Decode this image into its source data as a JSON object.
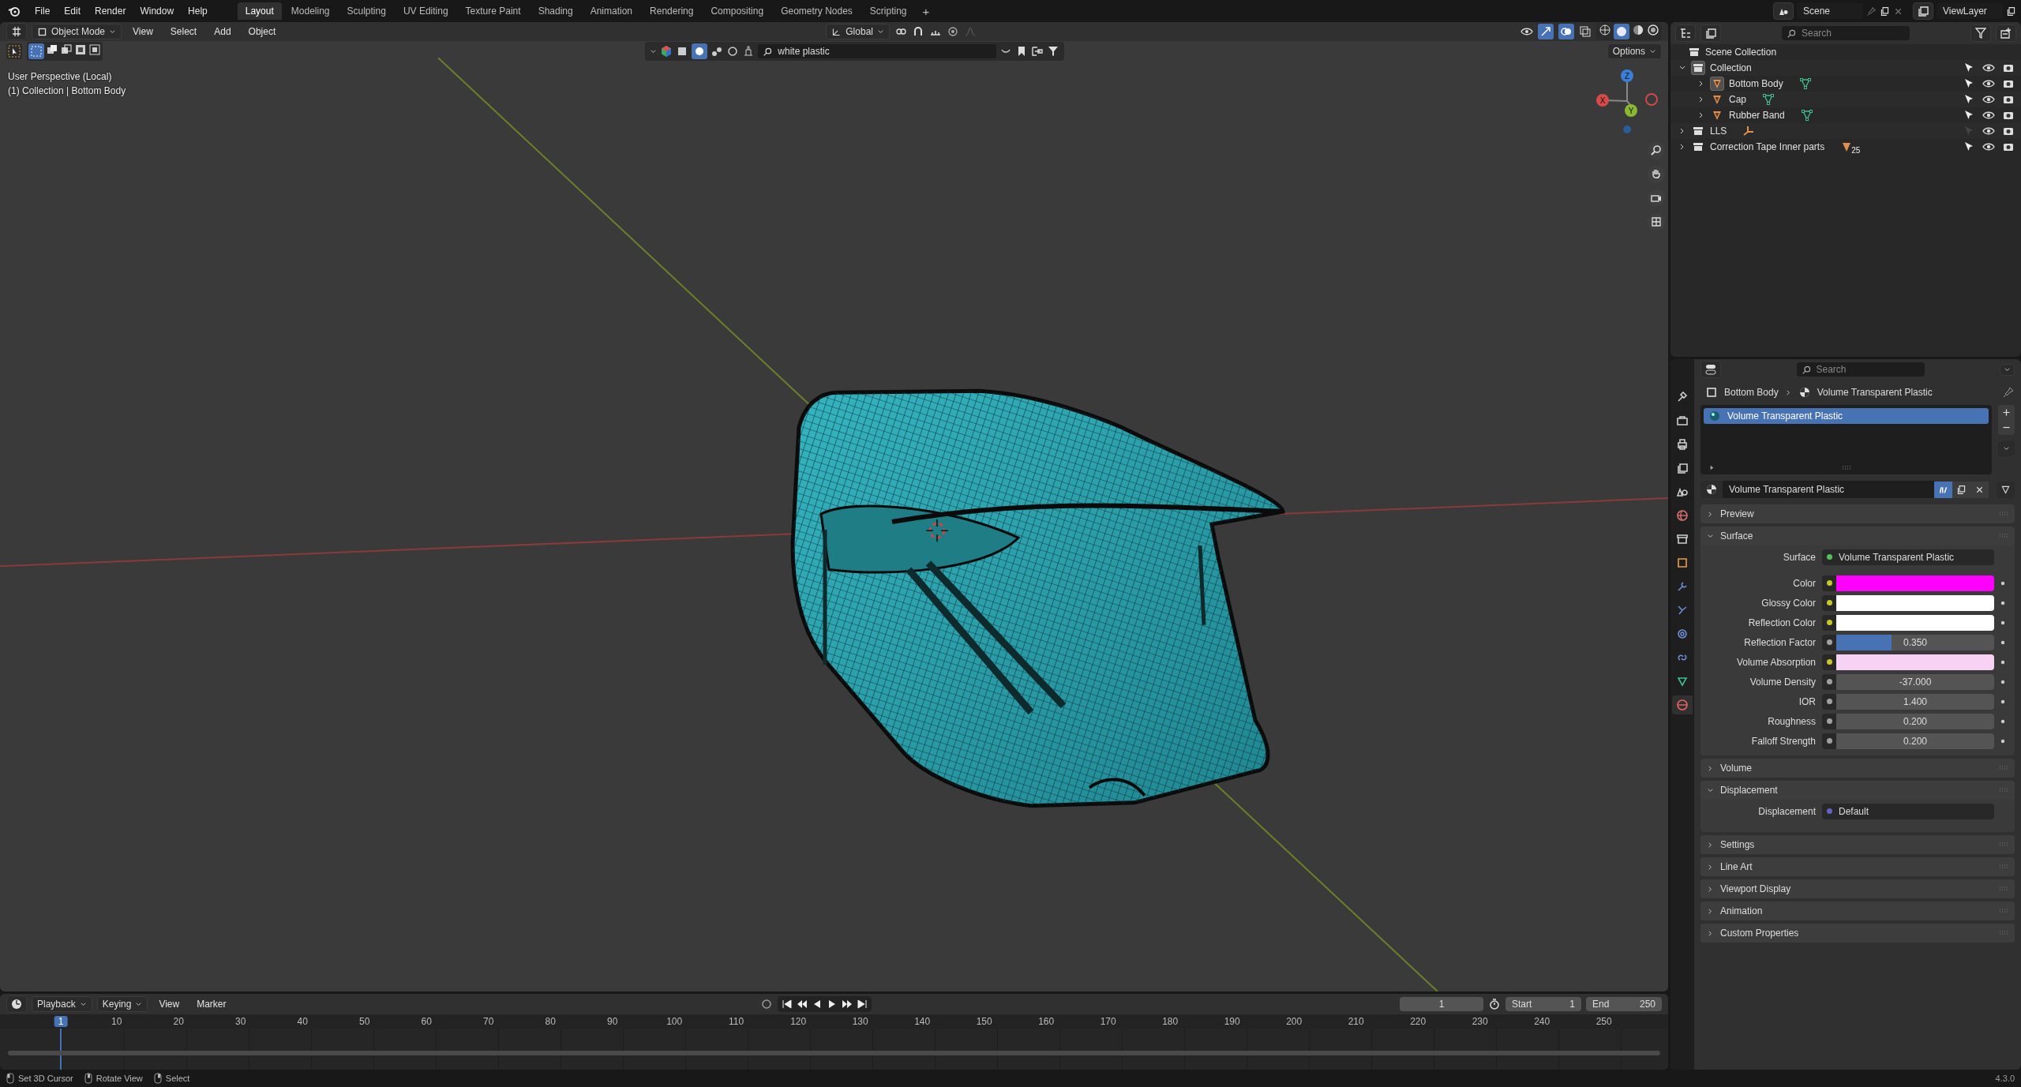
{
  "menu_bar": {
    "menus": [
      "File",
      "Edit",
      "Render",
      "Window",
      "Help"
    ],
    "workspaces": [
      {
        "label": "Layout",
        "selected": true
      },
      {
        "label": "Modeling",
        "selected": false
      },
      {
        "label": "Sculpting",
        "selected": false
      },
      {
        "label": "UV Editing",
        "selected": false
      },
      {
        "label": "Texture Paint",
        "selected": false
      },
      {
        "label": "Shading",
        "selected": false
      },
      {
        "label": "Animation",
        "selected": false
      },
      {
        "label": "Rendering",
        "selected": false
      },
      {
        "label": "Compositing",
        "selected": false
      },
      {
        "label": "Geometry Nodes",
        "selected": false
      },
      {
        "label": "Scripting",
        "selected": false
      }
    ],
    "add_tab": "+",
    "scene": "Scene",
    "view_layer": "ViewLayer"
  },
  "viewport": {
    "mode": "Object Mode",
    "menus": [
      "View",
      "Select",
      "Add",
      "Object"
    ],
    "orientation": "Global",
    "search": "white plastic",
    "options": "Options",
    "info": [
      "User Perspective (Local)",
      "(1) Collection | Bottom Body"
    ],
    "gizmo_labels": [
      "X",
      "Y",
      "Z"
    ]
  },
  "outliner": {
    "search_placeholder": "Search",
    "root": "Scene Collection",
    "items": [
      {
        "label": "Collection",
        "kind": "collection",
        "expanded": true,
        "active": true,
        "selectable": true,
        "children": [
          {
            "label": "Bottom Body",
            "kind": "mesh_object",
            "expanded": false,
            "active": true,
            "selectable": true,
            "data_icon": {
              "kind": "mesh"
            }
          },
          {
            "label": "Cap",
            "kind": "mesh_object",
            "expanded": false,
            "active": false,
            "selectable": true,
            "data_icon": {
              "kind": "mesh"
            }
          },
          {
            "label": "Rubber Band",
            "kind": "mesh_object",
            "expanded": false,
            "active": false,
            "selectable": true,
            "data_icon": {
              "kind": "mesh"
            }
          }
        ]
      },
      {
        "label": "LLS",
        "kind": "collection",
        "expanded": false,
        "active": false,
        "selectable": false,
        "data_icon": {
          "kind": "empty"
        }
      },
      {
        "label": "Correction Tape Inner parts",
        "kind": "collection",
        "expanded": false,
        "active": false,
        "selectable": true,
        "data_icon": {
          "kind": "objects",
          "count": "25"
        }
      }
    ]
  },
  "properties": {
    "search_placeholder": "Search",
    "tabs": [
      {
        "kind": "tool",
        "selected": false
      },
      {
        "kind": "render",
        "selected": false
      },
      {
        "kind": "output",
        "selected": false
      },
      {
        "kind": "view_layer",
        "selected": false
      },
      {
        "kind": "scene",
        "selected": false
      },
      {
        "kind": "world",
        "selected": false
      },
      {
        "kind": "collection",
        "selected": false
      },
      {
        "kind": "object",
        "selected": false
      },
      {
        "kind": "modifiers",
        "selected": false
      },
      {
        "kind": "particles",
        "selected": false
      },
      {
        "kind": "physics",
        "selected": false
      },
      {
        "kind": "constraints",
        "selected": false
      },
      {
        "kind": "data",
        "selected": false
      },
      {
        "kind": "material",
        "selected": true
      }
    ],
    "breadcrumb": [
      "Bottom Body",
      "Volume Transparent Plastic"
    ],
    "slots": [
      {
        "label": "Volume Transparent Plastic",
        "selected": true
      }
    ],
    "material_name": "Volume Transparent Plastic",
    "panels": [
      {
        "title": "Preview",
        "expanded": false
      },
      {
        "title": "Surface",
        "expanded": true,
        "fields": [
          {
            "label": "Surface",
            "kind": "link",
            "socket": {
              "color": "#4fc35a"
            },
            "value": "Volume Transparent Plastic"
          },
          {
            "label": "Color",
            "kind": "color",
            "socket": {
              "color": "#c7c729"
            },
            "color": "#ff00ff"
          },
          {
            "label": "Glossy Color",
            "kind": "color",
            "socket": {
              "color": "#c7c729"
            },
            "color": "#ffffff"
          },
          {
            "label": "Reflection Color",
            "kind": "color",
            "socket": {
              "color": "#c7c729"
            },
            "color": "#ffffff"
          },
          {
            "label": "Reflection Factor",
            "kind": "slider",
            "socket": {
              "color": "#a1a1a1"
            },
            "level": 0.35,
            "value": "0.350"
          },
          {
            "label": "Volume Absorption",
            "kind": "color",
            "socket": {
              "color": "#c7c729"
            },
            "color": "#f8d2f4"
          },
          {
            "label": "Volume Density",
            "kind": "number",
            "socket": {
              "color": "#a1a1a1"
            },
            "value": "-37.000"
          },
          {
            "label": "IOR",
            "kind": "number",
            "socket": {
              "color": "#a1a1a1"
            },
            "value": "1.400"
          },
          {
            "label": "Roughness",
            "kind": "number",
            "socket": {
              "color": "#a1a1a1"
            },
            "value": "0.200"
          },
          {
            "label": "Falloff Strength",
            "kind": "number",
            "socket": {
              "color": "#a1a1a1"
            },
            "value": "0.200"
          }
        ]
      },
      {
        "title": "Volume",
        "expanded": false
      },
      {
        "title": "Displacement",
        "expanded": true,
        "fields": [
          {
            "label": "Displacement",
            "kind": "link",
            "socket": {
              "color": "#6363c7"
            },
            "value": "Default"
          }
        ]
      },
      {
        "title": "Settings",
        "expanded": false
      },
      {
        "title": "Line Art",
        "expanded": false
      },
      {
        "title": "Viewport Display",
        "expanded": false
      },
      {
        "title": "Animation",
        "expanded": false
      },
      {
        "title": "Custom Properties",
        "expanded": false
      }
    ]
  },
  "timeline": {
    "menus": [
      "Playback",
      "Keying",
      "View",
      "Marker"
    ],
    "current_frame": "1",
    "start_label": "Start",
    "start": "1",
    "end_label": "End",
    "end": "250",
    "ruler": [
      {
        "label": "1",
        "selected": true
      },
      {
        "label": "10",
        "selected": false
      },
      {
        "label": "20",
        "selected": false
      },
      {
        "label": "30",
        "selected": false
      },
      {
        "label": "40",
        "selected": false
      },
      {
        "label": "50",
        "selected": false
      },
      {
        "label": "60",
        "selected": false
      },
      {
        "label": "70",
        "selected": false
      },
      {
        "label": "80",
        "selected": false
      },
      {
        "label": "90",
        "selected": false
      },
      {
        "label": "100",
        "selected": false
      },
      {
        "label": "110",
        "selected": false
      },
      {
        "label": "120",
        "selected": false
      },
      {
        "label": "130",
        "selected": false
      },
      {
        "label": "140",
        "selected": false
      },
      {
        "label": "150",
        "selected": false
      },
      {
        "label": "160",
        "selected": false
      },
      {
        "label": "170",
        "selected": false
      },
      {
        "label": "180",
        "selected": false
      },
      {
        "label": "190",
        "selected": false
      },
      {
        "label": "200",
        "selected": false
      },
      {
        "label": "210",
        "selected": false
      },
      {
        "label": "220",
        "selected": false
      },
      {
        "label": "230",
        "selected": false
      },
      {
        "label": "240",
        "selected": false
      },
      {
        "label": "250",
        "selected": false
      }
    ]
  },
  "status_bar": {
    "hints": [
      "Set 3D Cursor",
      "Rotate View",
      "Select"
    ],
    "version": "4.3.0"
  }
}
